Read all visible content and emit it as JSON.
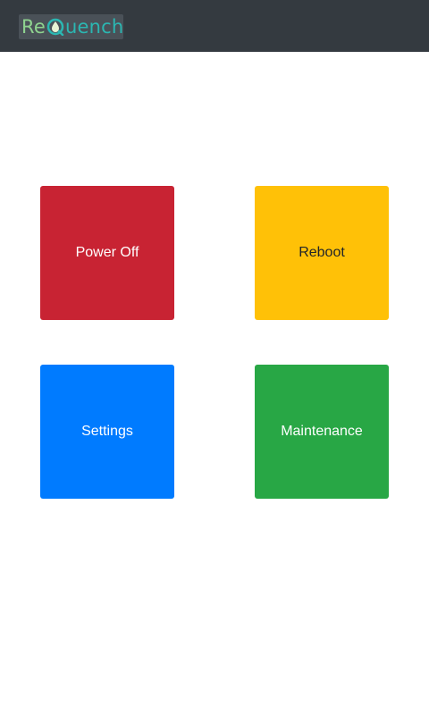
{
  "header": {
    "logo": {
      "text_part1": "Re",
      "text_part2": "uench",
      "full_text": "ReQuench"
    }
  },
  "tiles": [
    {
      "label": "Power Off",
      "color": "#c82333"
    },
    {
      "label": "Reboot",
      "color": "#ffc107"
    },
    {
      "label": "Settings",
      "color": "#007bff"
    },
    {
      "label": "Maintenance",
      "color": "#28a745"
    }
  ]
}
